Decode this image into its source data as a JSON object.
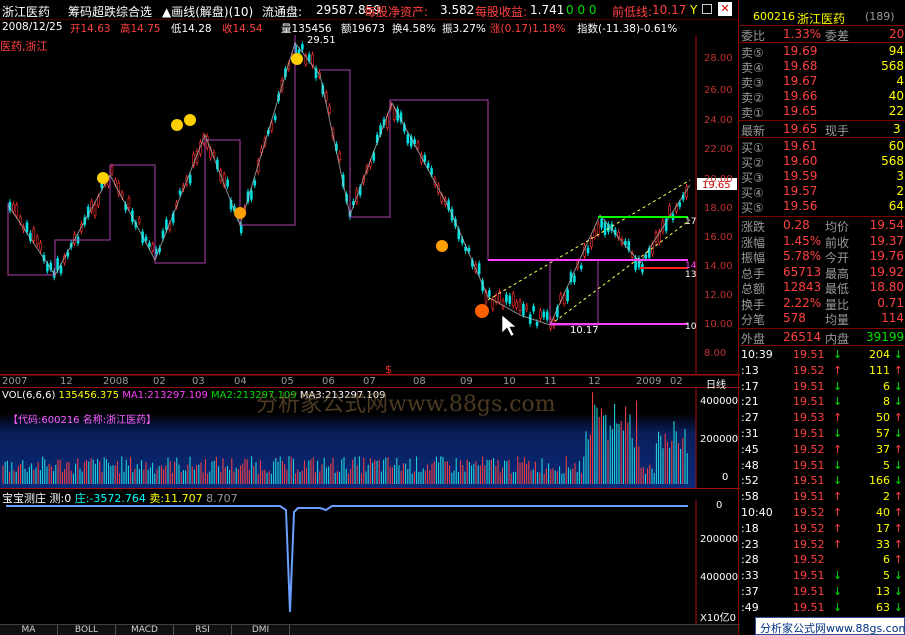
{
  "title_bar": {
    "stock_name": "浙江医药",
    "menu": "筹码超跌综合选",
    "period": "▲画线(解盘)(10)",
    "float_label": "流通盘:",
    "float_value": "29587.859",
    "nav_label": "每股净资产:",
    "nav_value": "3.582",
    "eps_label": "每股收益:",
    "eps_value": "1.741",
    "zeros": "0 0 0",
    "prev_low_label": "前低线:",
    "prev_low_value": "10.17",
    "y_mark": "Y"
  },
  "info_line": {
    "date": "2008/12/25",
    "open": "开14.63",
    "high": "高14.75",
    "low": "低14.28",
    "close": "收14.54",
    "volume": "量135456",
    "amount": "额19673",
    "turnover": "换4.58%",
    "amplitude": "振3.27%",
    "change": "涨(0.17)1.18%",
    "index": "指数(-11.38)-0.61%"
  },
  "sector_label": "医药,浙江",
  "price_axis": [
    "28.00",
    "26.00",
    "24.00",
    "22.00",
    "20.00",
    "18.00",
    "16.00",
    "14.00",
    "12.00",
    "10.00",
    "8.00"
  ],
  "chart_labels": {
    "peak": "29.51",
    "bottom": "10.17",
    "last_price": "19.65",
    "line17": "17",
    "line14": "14",
    "line13": "13",
    "line10": "10",
    "dollar": "$"
  },
  "time_axis": [
    "2007",
    "12",
    "2008",
    "02",
    "03",
    "04",
    "05",
    "06",
    "07",
    "08",
    "09",
    "10",
    "11",
    "12",
    "2009",
    "02"
  ],
  "time_axis_right": "日线",
  "volume_panel": {
    "header": "VOL(6,6,6)",
    "vol": "135456.375",
    "ma1": "MA1:213297.109",
    "ma2": "MA2:213297.109",
    "ma3": "MA3:213297.109",
    "code_note": "【代码:600216 名称:浙江医药】",
    "axis": [
      "400000",
      "200000",
      "0"
    ]
  },
  "watermark": "分析家公式网www.88gs.com",
  "indicator_panel": {
    "name": "宝宝测庄",
    "measure": "测:0",
    "zhuang": "庄:-3572.764",
    "sell": "卖:11.707",
    "extra": "8.707",
    "axis": [
      "0",
      "200000",
      "400000"
    ],
    "unit": "X10亿0"
  },
  "bottom_tabs": [
    "MA",
    "BOLL",
    "MACD",
    "RSI",
    "DMI"
  ],
  "right_panel": {
    "code": "600216",
    "name": "浙江医药",
    "count": "(189)",
    "weibi_label": "委比",
    "weibi": "1.33%",
    "weicha_label": "委差",
    "weicha": "20",
    "asks": [
      {
        "label": "卖⑤",
        "price": "19.69",
        "vol": "94"
      },
      {
        "label": "卖④",
        "price": "19.68",
        "vol": "568"
      },
      {
        "label": "卖③",
        "price": "19.67",
        "vol": "4"
      },
      {
        "label": "卖②",
        "price": "19.66",
        "vol": "40"
      },
      {
        "label": "卖①",
        "price": "19.65",
        "vol": "22"
      }
    ],
    "latest_label": "最新",
    "latest": "19.65",
    "current_hand_label": "现手",
    "current_hand": "3",
    "bids": [
      {
        "label": "买①",
        "price": "19.61",
        "vol": "60"
      },
      {
        "label": "买②",
        "price": "19.60",
        "vol": "568"
      },
      {
        "label": "买③",
        "price": "19.59",
        "vol": "3"
      },
      {
        "label": "买④",
        "price": "19.57",
        "vol": "2"
      },
      {
        "label": "买⑤",
        "price": "19.56",
        "vol": "64"
      }
    ],
    "stats": [
      {
        "l1": "涨跌",
        "v1": "0.28",
        "l2": "均价",
        "v2": "19.54"
      },
      {
        "l1": "涨幅",
        "v1": "1.45%",
        "l2": "前收",
        "v2": "19.37"
      },
      {
        "l1": "振幅",
        "v1": "5.78%",
        "l2": "今开",
        "v2": "19.76"
      },
      {
        "l1": "总手",
        "v1": "65713",
        "l2": "最高",
        "v2": "19.92"
      },
      {
        "l1": "总额",
        "v1": "12843",
        "l2": "最低",
        "v2": "18.80"
      },
      {
        "l1": "换手",
        "v1": "2.22%",
        "l2": "量比",
        "v2": "0.71"
      },
      {
        "l1": "分笔",
        "v1": "578",
        "l2": "均量",
        "v2": "114"
      }
    ],
    "outer_label": "外盘",
    "outer": "26514",
    "inner_label": "内盘",
    "inner": "39199",
    "ticks": [
      {
        "t": "10:39",
        "p": "19.51",
        "a": "↓",
        "v": "204",
        "c": "grn"
      },
      {
        "t": ":13",
        "p": "19.52",
        "a": "↑",
        "v": "111",
        "c": "red"
      },
      {
        "t": ":17",
        "p": "19.51",
        "a": "↓",
        "v": "6",
        "c": "grn"
      },
      {
        "t": ":21",
        "p": "19.51",
        "a": "↓",
        "v": "8",
        "c": "grn"
      },
      {
        "t": ":27",
        "p": "19.53",
        "a": "↑",
        "v": "50",
        "c": "red"
      },
      {
        "t": ":31",
        "p": "19.51",
        "a": "↓",
        "v": "57",
        "c": "grn"
      },
      {
        "t": ":45",
        "p": "19.52",
        "a": "↑",
        "v": "37",
        "c": "red"
      },
      {
        "t": ":48",
        "p": "19.51",
        "a": "↓",
        "v": "5",
        "c": "grn"
      },
      {
        "t": ":52",
        "p": "19.51",
        "a": "↓",
        "v": "166",
        "c": "grn"
      },
      {
        "t": ":58",
        "p": "19.51",
        "a": "↑",
        "v": "2",
        "c": "red"
      },
      {
        "t": "10:40",
        "p": "19.52",
        "a": "↑",
        "v": "40",
        "c": "red"
      },
      {
        "t": ":18",
        "p": "19.52",
        "a": "↑",
        "v": "17",
        "c": "red"
      },
      {
        "t": ":23",
        "p": "19.52",
        "a": "↑",
        "v": "33",
        "c": "red"
      },
      {
        "t": ":28",
        "p": "19.52",
        "a": "",
        "v": "6",
        "c": "red"
      },
      {
        "t": ":33",
        "p": "19.51",
        "a": "↓",
        "v": "5",
        "c": "grn"
      },
      {
        "t": ":37",
        "p": "19.51",
        "a": "↓",
        "v": "13",
        "c": "grn"
      },
      {
        "t": ":49",
        "p": "19.51",
        "a": "↓",
        "v": "63",
        "c": "grn"
      }
    ]
  },
  "footer": "分析家公式网www.88gs.com",
  "colors": {
    "up": "#ff3030",
    "down": "#00ffff",
    "bg": "#000000",
    "accent": "#ffff00"
  }
}
